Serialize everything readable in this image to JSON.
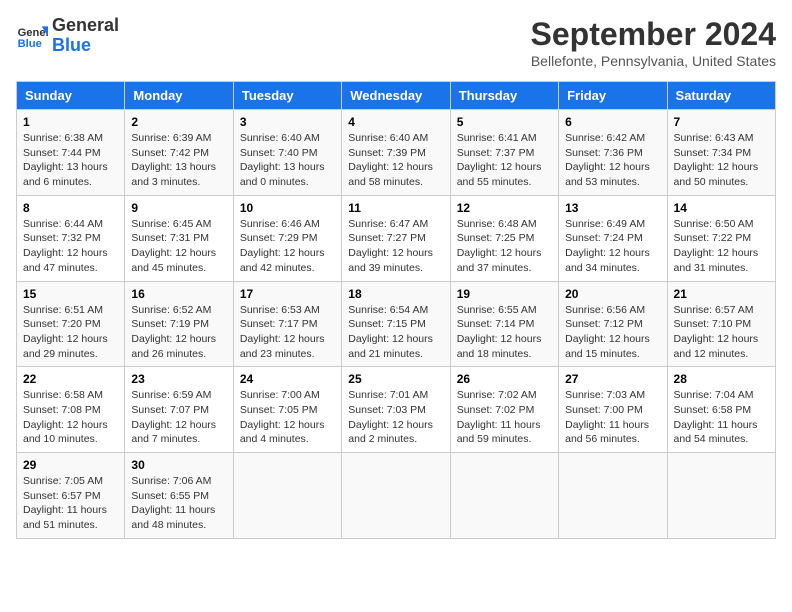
{
  "header": {
    "logo_line1": "General",
    "logo_line2": "Blue",
    "month": "September 2024",
    "location": "Bellefonte, Pennsylvania, United States"
  },
  "days_of_week": [
    "Sunday",
    "Monday",
    "Tuesday",
    "Wednesday",
    "Thursday",
    "Friday",
    "Saturday"
  ],
  "weeks": [
    [
      {
        "day": "1",
        "sunrise": "6:38 AM",
        "sunset": "7:44 PM",
        "daylight": "13 hours and 6 minutes."
      },
      {
        "day": "2",
        "sunrise": "6:39 AM",
        "sunset": "7:42 PM",
        "daylight": "13 hours and 3 minutes."
      },
      {
        "day": "3",
        "sunrise": "6:40 AM",
        "sunset": "7:40 PM",
        "daylight": "13 hours and 0 minutes."
      },
      {
        "day": "4",
        "sunrise": "6:40 AM",
        "sunset": "7:39 PM",
        "daylight": "12 hours and 58 minutes."
      },
      {
        "day": "5",
        "sunrise": "6:41 AM",
        "sunset": "7:37 PM",
        "daylight": "12 hours and 55 minutes."
      },
      {
        "day": "6",
        "sunrise": "6:42 AM",
        "sunset": "7:36 PM",
        "daylight": "12 hours and 53 minutes."
      },
      {
        "day": "7",
        "sunrise": "6:43 AM",
        "sunset": "7:34 PM",
        "daylight": "12 hours and 50 minutes."
      }
    ],
    [
      {
        "day": "8",
        "sunrise": "6:44 AM",
        "sunset": "7:32 PM",
        "daylight": "12 hours and 47 minutes."
      },
      {
        "day": "9",
        "sunrise": "6:45 AM",
        "sunset": "7:31 PM",
        "daylight": "12 hours and 45 minutes."
      },
      {
        "day": "10",
        "sunrise": "6:46 AM",
        "sunset": "7:29 PM",
        "daylight": "12 hours and 42 minutes."
      },
      {
        "day": "11",
        "sunrise": "6:47 AM",
        "sunset": "7:27 PM",
        "daylight": "12 hours and 39 minutes."
      },
      {
        "day": "12",
        "sunrise": "6:48 AM",
        "sunset": "7:25 PM",
        "daylight": "12 hours and 37 minutes."
      },
      {
        "day": "13",
        "sunrise": "6:49 AM",
        "sunset": "7:24 PM",
        "daylight": "12 hours and 34 minutes."
      },
      {
        "day": "14",
        "sunrise": "6:50 AM",
        "sunset": "7:22 PM",
        "daylight": "12 hours and 31 minutes."
      }
    ],
    [
      {
        "day": "15",
        "sunrise": "6:51 AM",
        "sunset": "7:20 PM",
        "daylight": "12 hours and 29 minutes."
      },
      {
        "day": "16",
        "sunrise": "6:52 AM",
        "sunset": "7:19 PM",
        "daylight": "12 hours and 26 minutes."
      },
      {
        "day": "17",
        "sunrise": "6:53 AM",
        "sunset": "7:17 PM",
        "daylight": "12 hours and 23 minutes."
      },
      {
        "day": "18",
        "sunrise": "6:54 AM",
        "sunset": "7:15 PM",
        "daylight": "12 hours and 21 minutes."
      },
      {
        "day": "19",
        "sunrise": "6:55 AM",
        "sunset": "7:14 PM",
        "daylight": "12 hours and 18 minutes."
      },
      {
        "day": "20",
        "sunrise": "6:56 AM",
        "sunset": "7:12 PM",
        "daylight": "12 hours and 15 minutes."
      },
      {
        "day": "21",
        "sunrise": "6:57 AM",
        "sunset": "7:10 PM",
        "daylight": "12 hours and 12 minutes."
      }
    ],
    [
      {
        "day": "22",
        "sunrise": "6:58 AM",
        "sunset": "7:08 PM",
        "daylight": "12 hours and 10 minutes."
      },
      {
        "day": "23",
        "sunrise": "6:59 AM",
        "sunset": "7:07 PM",
        "daylight": "12 hours and 7 minutes."
      },
      {
        "day": "24",
        "sunrise": "7:00 AM",
        "sunset": "7:05 PM",
        "daylight": "12 hours and 4 minutes."
      },
      {
        "day": "25",
        "sunrise": "7:01 AM",
        "sunset": "7:03 PM",
        "daylight": "12 hours and 2 minutes."
      },
      {
        "day": "26",
        "sunrise": "7:02 AM",
        "sunset": "7:02 PM",
        "daylight": "11 hours and 59 minutes."
      },
      {
        "day": "27",
        "sunrise": "7:03 AM",
        "sunset": "7:00 PM",
        "daylight": "11 hours and 56 minutes."
      },
      {
        "day": "28",
        "sunrise": "7:04 AM",
        "sunset": "6:58 PM",
        "daylight": "11 hours and 54 minutes."
      }
    ],
    [
      {
        "day": "29",
        "sunrise": "7:05 AM",
        "sunset": "6:57 PM",
        "daylight": "11 hours and 51 minutes."
      },
      {
        "day": "30",
        "sunrise": "7:06 AM",
        "sunset": "6:55 PM",
        "daylight": "11 hours and 48 minutes."
      },
      null,
      null,
      null,
      null,
      null
    ]
  ],
  "labels": {
    "sunrise": "Sunrise:",
    "sunset": "Sunset:",
    "daylight": "Daylight:"
  }
}
